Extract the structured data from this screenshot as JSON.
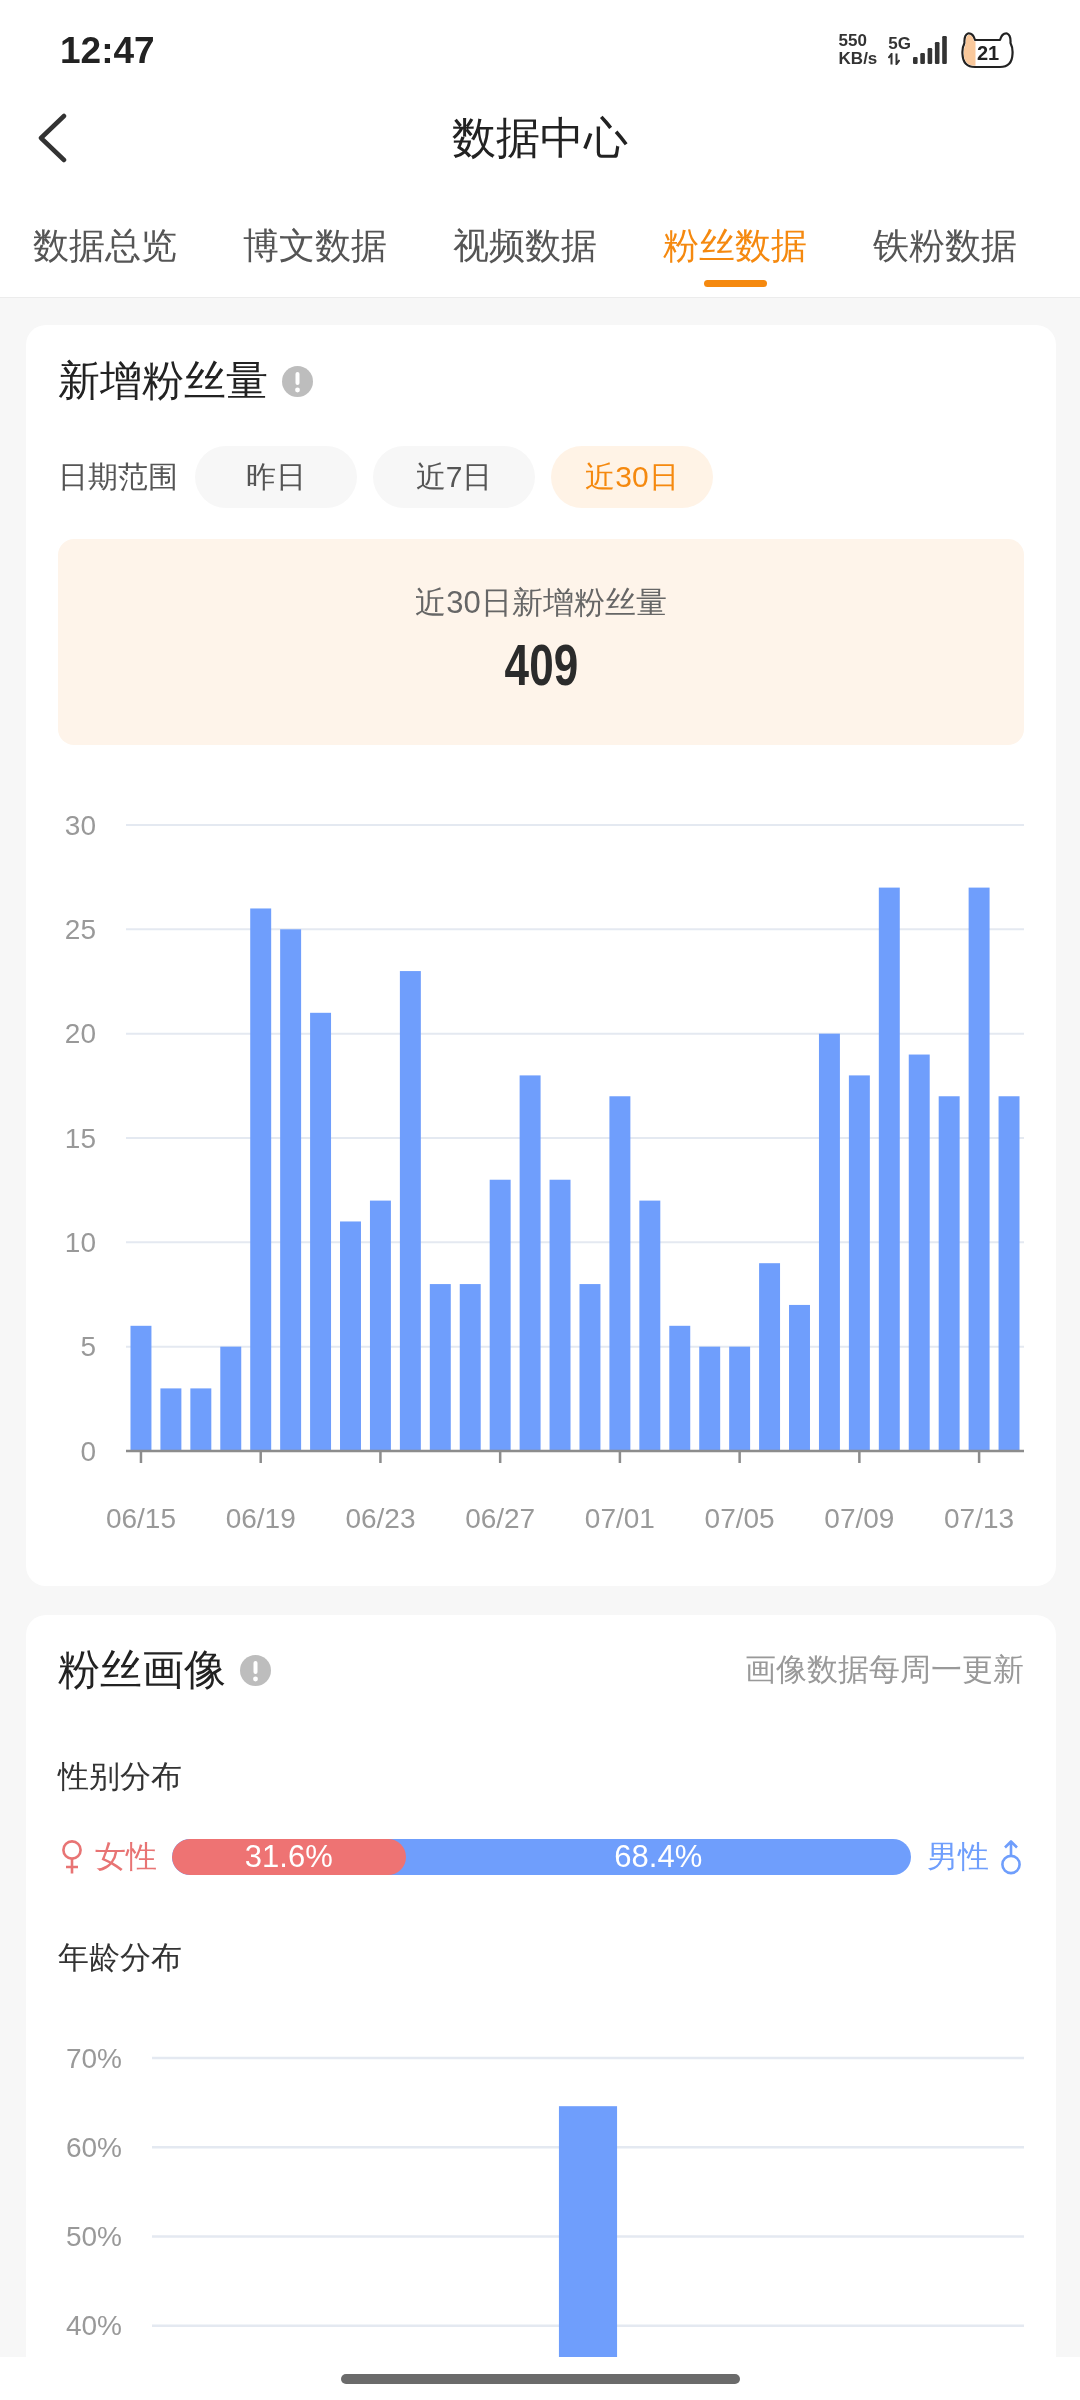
{
  "status_bar": {
    "time": "12:47",
    "network_speed": "550",
    "network_speed_unit": "KB/s",
    "network_type": "5G",
    "battery": "21"
  },
  "header": {
    "title": "数据中心"
  },
  "tabs": [
    {
      "label": "数据总览",
      "selected": false
    },
    {
      "label": "博文数据",
      "selected": false
    },
    {
      "label": "视频数据",
      "selected": false
    },
    {
      "label": "粉丝数据",
      "selected": true
    },
    {
      "label": "铁粉数据",
      "selected": false
    }
  ],
  "new_followers": {
    "title": "新增粉丝量",
    "date_range": {
      "label": "日期范围",
      "options": [
        {
          "label": "昨日",
          "selected": false
        },
        {
          "label": "近7日",
          "selected": false
        },
        {
          "label": "近30日",
          "selected": true
        }
      ]
    },
    "summary": {
      "label": "近30日新增粉丝量",
      "value": "409"
    },
    "chart_data": {
      "type": "bar",
      "categories": [
        "06/15",
        null,
        null,
        null,
        "06/19",
        null,
        null,
        null,
        "06/23",
        null,
        null,
        null,
        "06/27",
        null,
        null,
        null,
        "07/01",
        null,
        null,
        null,
        "07/05",
        null,
        null,
        null,
        "07/09",
        null,
        null,
        null,
        "07/13",
        null
      ],
      "values": [
        6,
        3,
        3,
        5,
        26,
        25,
        21,
        11,
        12,
        23,
        8,
        8,
        13,
        18,
        13,
        8,
        17,
        12,
        6,
        5,
        5,
        9,
        7,
        20,
        18,
        27,
        19,
        17,
        27,
        17
      ],
      "ylim": [
        0,
        30
      ],
      "yticks": [
        0,
        5,
        10,
        15,
        20,
        25,
        30
      ],
      "grid": true
    }
  },
  "follower_profile": {
    "title": "粉丝画像",
    "note": "画像数据每周一更新",
    "gender": {
      "title": "性别分布",
      "female": {
        "label": "女性",
        "share": "31.6%"
      },
      "male": {
        "label": "男性",
        "share": "68.4%"
      },
      "level": 0.316
    },
    "age": {
      "title": "年龄分布",
      "chart_data": {
        "type": "bar",
        "values": [
          null,
          null,
          64.6,
          null,
          null
        ],
        "ylim": [
          36.5,
          70
        ],
        "yticks": [
          {
            "value": 40,
            "label": "40%"
          },
          {
            "value": 50,
            "label": "50%"
          },
          {
            "value": 60,
            "label": "60%"
          },
          {
            "value": 70,
            "label": "70%"
          }
        ],
        "grid": true
      }
    }
  }
}
